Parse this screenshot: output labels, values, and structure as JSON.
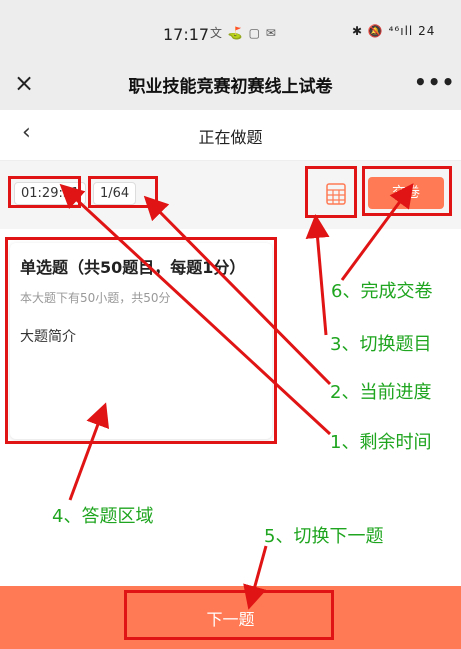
{
  "status_bar": {
    "time": "17:17",
    "app_icons": "文 ⛳ ▢ ✉",
    "right_icons": "✱ 🔕 ⁴⁶ıll 24"
  },
  "title_bar": {
    "title": "职业技能竞赛初赛线上试卷",
    "close_icon": "×",
    "more_icon": "•••"
  },
  "nav": {
    "back_icon": "‹",
    "title": "正在做题"
  },
  "exam_info": {
    "timer": "01:29:51",
    "progress": "1/64",
    "submit_label": "交卷"
  },
  "question_section": {
    "title": "单选题（共50题目，每题1分）",
    "description": "本大题下有50小题，共50分",
    "intro": "大题简介"
  },
  "footer": {
    "next_label": "下一题"
  },
  "annotations": {
    "a1": "1、剩余时间",
    "a2": "2、当前进度",
    "a3": "3、切换题目",
    "a4": "4、答题区域",
    "a5": "5、切换下一题",
    "a6": "6、完成交卷"
  },
  "colors": {
    "accent": "#ff7a55",
    "annotation_box": "#e01414",
    "annotation_text": "#1fa51f"
  }
}
